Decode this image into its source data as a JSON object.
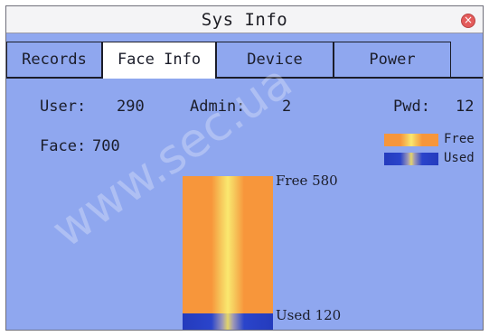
{
  "window": {
    "title": "Sys Info",
    "close_icon": "close-icon"
  },
  "tabs": [
    {
      "label": "Records",
      "active": false
    },
    {
      "label": "Face Info",
      "active": true
    },
    {
      "label": "Device",
      "active": false
    },
    {
      "label": "Power",
      "active": false
    }
  ],
  "stats": {
    "user_label": "User:",
    "user_value": "290",
    "admin_label": "Admin:",
    "admin_value": "2",
    "pwd_label": "Pwd:",
    "pwd_value": "12",
    "face_label": "Face:",
    "face_value": "700"
  },
  "legend": {
    "free_label": "Free",
    "used_label": "Used"
  },
  "chart_data": {
    "type": "bar",
    "categories": [
      "Free",
      "Used"
    ],
    "values": [
      580,
      120
    ],
    "labels": [
      "Free 580",
      "Used 120"
    ]
  },
  "watermark": "www.sec.ua",
  "colors": {
    "background": "#8fa7ef",
    "free": "#f7963b",
    "used": "#2a44cb"
  }
}
